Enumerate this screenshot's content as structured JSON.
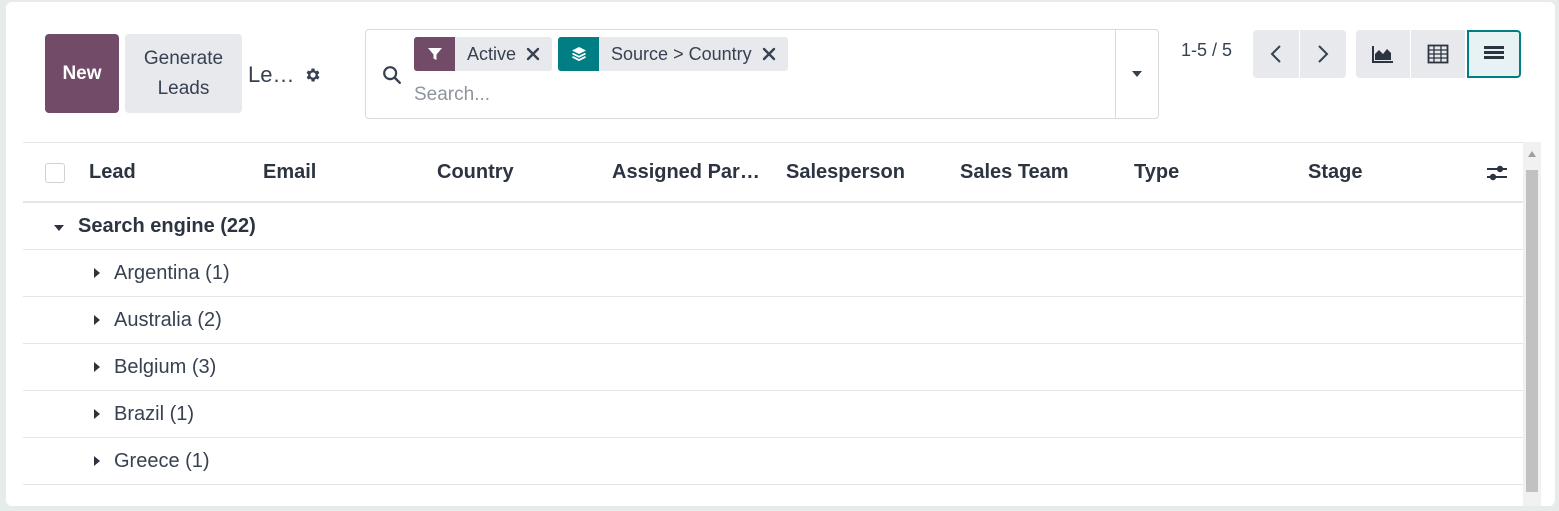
{
  "control_panel": {
    "new_label": "New",
    "generate_label": "Generate Leads",
    "breadcrumb": "Le…"
  },
  "search": {
    "facets": [
      {
        "type": "filter",
        "label": "Active",
        "icon": "filter-icon"
      },
      {
        "type": "groupby",
        "label": "Source > Country",
        "icon": "layers-icon"
      }
    ],
    "placeholder": "Search..."
  },
  "pager": {
    "text": "1-5 / 5"
  },
  "views": [
    "graph-view",
    "pivot-view",
    "list-view"
  ],
  "table": {
    "columns": [
      "Lead",
      "Email",
      "Country",
      "Assigned Par…",
      "Salesperson",
      "Sales Team",
      "Type",
      "Stage"
    ],
    "groups": [
      {
        "label": "Search engine (22)",
        "expanded": true,
        "level": 0
      },
      {
        "label": "Argentina (1)",
        "expanded": false,
        "level": 1
      },
      {
        "label": "Australia (2)",
        "expanded": false,
        "level": 1
      },
      {
        "label": "Belgium (3)",
        "expanded": false,
        "level": 1
      },
      {
        "label": "Brazil (1)",
        "expanded": false,
        "level": 1
      },
      {
        "label": "Greece (1)",
        "expanded": false,
        "level": 1
      }
    ]
  },
  "colors": {
    "primary": "#714b67",
    "accent": "#017e84",
    "neutral_btn": "#e7e9ed"
  }
}
